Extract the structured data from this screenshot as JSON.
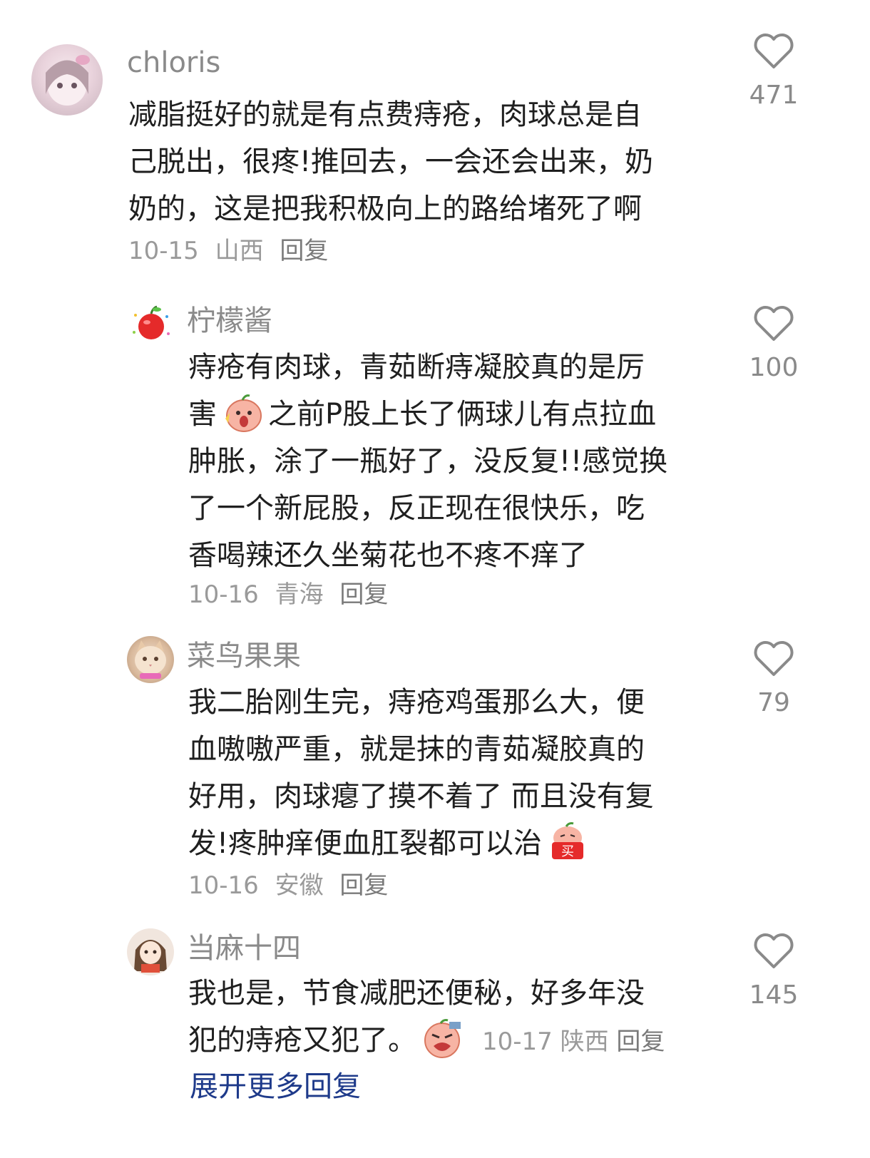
{
  "comments": [
    {
      "username": "chloris",
      "lines": [
        "减脂挺好的就是有点费痔疮，肉球总是自",
        "己脱出，很疼!推回去，一会还会出来，奶",
        "奶的，这是把我积极向上的路给堵死了啊"
      ],
      "date": "10-15",
      "location": "山西",
      "reply_label": "回复",
      "likes": "471"
    },
    {
      "username": "柠檬酱",
      "lines": [
        "痔疮有肉球，青茹断痔凝胶真的是厉",
        [
          "害",
          "之前P股上长了俩球儿有点拉血"
        ],
        "肿胀，涂了一瓶好了，没反复!!感觉换",
        "了一个新屁股，反正现在很快乐，吃",
        "香喝辣还久坐菊花也不疼不痒了"
      ],
      "date": "10-16",
      "location": "青海",
      "reply_label": "回复",
      "likes": "100"
    },
    {
      "username": "菜鸟果果",
      "lines": [
        "我二胎刚生完，痔疮鸡蛋那么大，便",
        "血嗷嗷严重，就是抹的青茹凝胶真的",
        "好用，肉球瘪了摸不着了 而且没有复",
        "发!疼肿痒便血肛裂都可以治"
      ],
      "date": "10-16",
      "location": "安徽",
      "reply_label": "回复",
      "likes": "79"
    },
    {
      "username": "当麻十四",
      "lines": [
        "我也是，节食减肥还便秘，好多年没",
        "犯的痔疮又犯了。"
      ],
      "date": "10-17",
      "location": "陕西",
      "reply_label": "回复",
      "likes": "145"
    }
  ],
  "emoji": {
    "sticker_buy_text": "买"
  },
  "expand_replies_label": "展开更多回复",
  "colors": {
    "username": "#8a8a8a",
    "body": "#1f1f1f",
    "meta": "#9a9a9a",
    "link": "#1e3a8a",
    "heart_stroke": "#8a8a8a"
  }
}
